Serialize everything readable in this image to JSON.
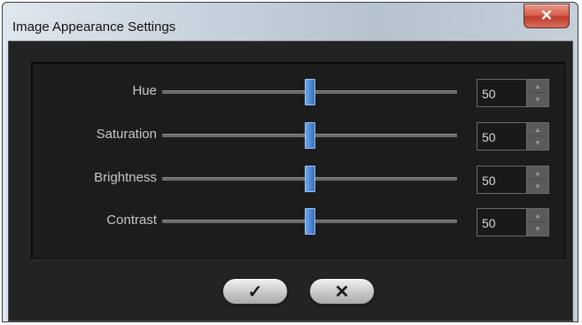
{
  "window": {
    "title": "Image Appearance Settings",
    "close_glyph": "✕"
  },
  "sliders": [
    {
      "label": "Hue",
      "value": "50",
      "fraction": 0.5
    },
    {
      "label": "Saturation",
      "value": "50",
      "fraction": 0.5
    },
    {
      "label": "Brightness",
      "value": "50",
      "fraction": 0.5
    },
    {
      "label": "Contrast",
      "value": "50",
      "fraction": 0.5
    }
  ],
  "spinner": {
    "up_glyph": "▲",
    "down_glyph": "▼"
  },
  "buttons": {
    "ok_glyph": "✓",
    "cancel_glyph": "✕"
  },
  "colors": {
    "panel_bg": "#1c1c1c",
    "thumb": "#4c86d4",
    "label_text": "#c8c8c8",
    "close_button": "#c0392b"
  }
}
